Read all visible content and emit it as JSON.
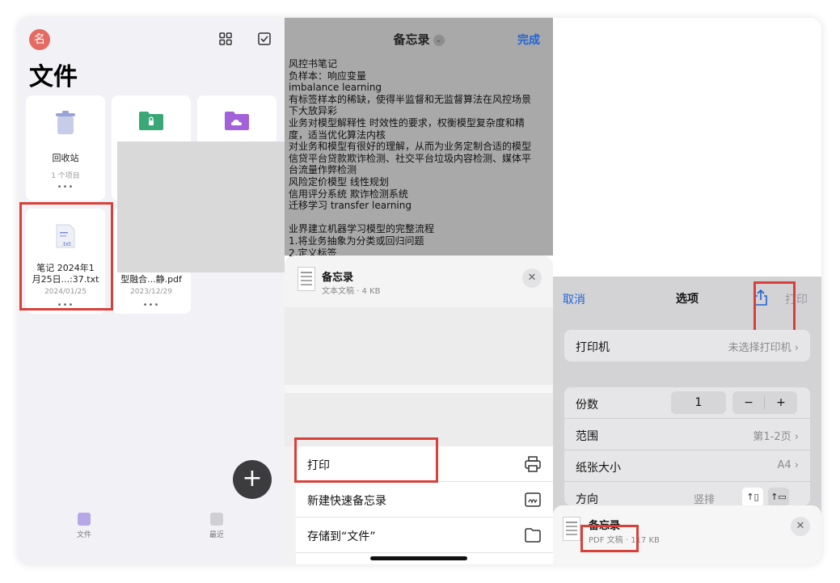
{
  "panel_files": {
    "avatar": "名",
    "grid_icon": "grid-view-icon",
    "select_icon": "checkbox-select-icon",
    "title": "文件",
    "cards": [
      {
        "name": "回收站",
        "sub": "1 个项目",
        "dots": "•••",
        "icon": "trash-icon"
      },
      {
        "name": "",
        "icon": "lock-folder-icon",
        "color": "#3aa776"
      },
      {
        "name": "",
        "icon": "cloud-folder-icon",
        "color": "#a260d9"
      },
      {
        "name_line1": "笔记 2024年1",
        "name_line2": "月25日...:37.txt",
        "date": "2024/01/25",
        "dots": "•••",
        "ext": ".txt"
      },
      {
        "name": "型融合...静.pdf",
        "date": "2023/12/29",
        "dots": "•••"
      }
    ],
    "fab": "+",
    "tabs": [
      {
        "label": "文件",
        "icon": "folder-tab-icon"
      },
      {
        "label": "最近",
        "icon": "recent-tab-icon"
      }
    ],
    "highlight_color": "#d9403a"
  },
  "panel_notes": {
    "title": "备忘录",
    "chevron": "⌄",
    "done": "完成",
    "lines": [
      "风控书笔记",
      "负样本：响应变量",
      "imbalance learning",
      "有标签样本的稀缺，使得半监督和无监督算法在风控场景",
      "下大放异彩",
      "业务对模型解释性 时效性的要求，权衡模型复杂度和精",
      "度，适当优化算法内核",
      "对业务和模型有很好的理解，从而为业务定制合适的模型",
      "信贷平台贷款欺诈检测、社交平台垃圾内容检测、媒体平",
      "台流量作弊检测",
      "风险定价模型 线性规划",
      "信用评分系统 欺诈检测系统",
      "迁移学习 transfer learning",
      "",
      "业界建立机器学习模型的完整流程",
      "1.将业务抽象为分类或回归问题",
      "2.定义标签"
    ],
    "sheet": {
      "name": "备忘录",
      "sub": "文本文稿 · 4 KB",
      "close": "✕"
    },
    "actions": [
      {
        "label": "打印",
        "icon": "printer-icon"
      },
      {
        "label": "新建快速备忘录",
        "icon": "quick-note-icon"
      },
      {
        "label": "存储到“文件”",
        "icon": "folder-icon"
      }
    ]
  },
  "panel_print": {
    "cancel": "取消",
    "title": "选项",
    "print": "打印",
    "share_icon": "share-icon",
    "printer_label": "打印机",
    "printer_value": "未选择打印机",
    "copies_label": "份数",
    "copies_value": "1",
    "minus": "−",
    "plus": "+",
    "range_label": "范围",
    "range_value": "第1-2页",
    "paper_label": "纸张大小",
    "paper_value": "A4",
    "orient_label": "方向",
    "orient_value": "竖排",
    "chevron": "›",
    "preview": {
      "name": "备忘录",
      "type": "PDF 文稿",
      "size": " · 117 KB",
      "close": "✕"
    },
    "accent": "#1f64d6"
  }
}
